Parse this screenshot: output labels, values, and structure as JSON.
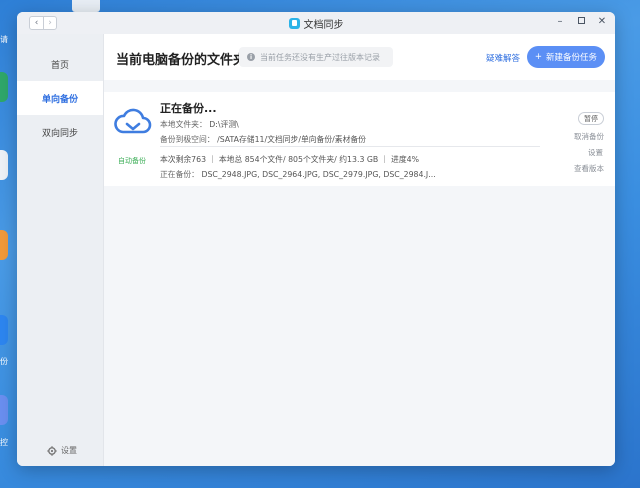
{
  "desktop": {
    "labels": [
      "请",
      "份",
      "控"
    ]
  },
  "window": {
    "title": "文档同步",
    "nav_back": "‹",
    "nav_forward": "›",
    "controls": {
      "minimize": "–",
      "close": "✕"
    }
  },
  "sidebar": {
    "items": [
      {
        "label": "首页"
      },
      {
        "label": "单向备份"
      },
      {
        "label": "双向同步"
      }
    ],
    "settings_label": "设置"
  },
  "header": {
    "page_title": "当前电脑备份的文件夹",
    "notice": "当前任务还没有生产过往版本记录",
    "help_link": "疑难解答",
    "new_task_button": "新建备份任务",
    "new_task_icon": "+"
  },
  "task": {
    "status_title": "正在备份...",
    "local_folder_label": "本地文件夹：",
    "local_folder_value": "D:\\评测\\",
    "target_label": "备份到极空间：",
    "target_value": "/SATA存储11/文档同步/单向备份/素材备份",
    "auto_tag": "自动备份",
    "progress_line": "本次剩余763 ｜ 本地总 854个文件/ 805个文件夹/ 约13.3 GB ｜ 进度4%",
    "current_label": "正在备份：",
    "current_files": "DSC_2948.JPG, DSC_2964.JPG, DSC_2979.JPG, DSC_2984.J...",
    "progress_percent": 4,
    "actions": {
      "pause": "暂停",
      "cancel": "取消备份",
      "settings": "设置",
      "view_versions": "查看版本"
    }
  },
  "colors": {
    "accent": "#2f6fe0",
    "button": "#5b8ff5",
    "auto_tag": "#3cae57",
    "cloud_icon": "#3f7de0"
  }
}
